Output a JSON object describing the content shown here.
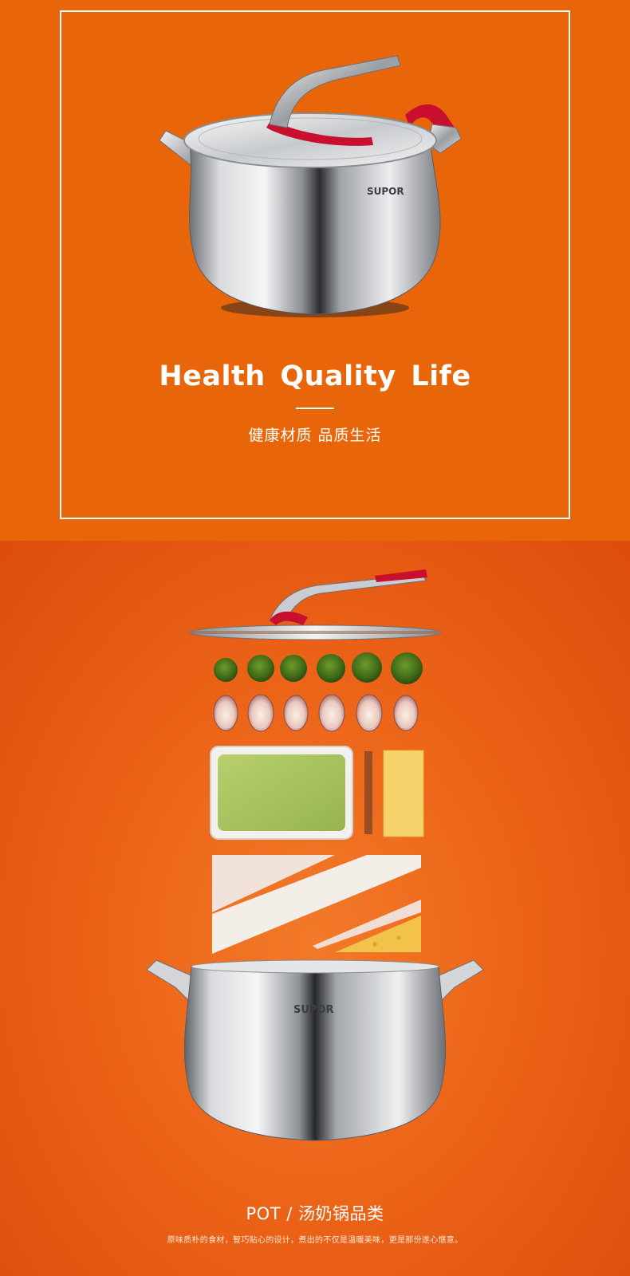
{
  "hero": {
    "title": "Health Quality Life",
    "subtitle": "健康材质 品质生活",
    "brand_mark": "SUPOR",
    "background_color": "#e8650a"
  },
  "flatlay": {
    "brand_mark": "SUPOR",
    "ingredient_rows": [
      {
        "name": "broccoli-row",
        "count": 6
      },
      {
        "name": "shallot-row",
        "count": 6
      }
    ]
  },
  "caption": {
    "title": "POT / 汤奶锅品类",
    "description": "原味质朴的食材，智巧贴心的设计，煮出的不仅是温暖美味，更是那份遂心惬意。"
  },
  "colors": {
    "orange": "#e8650a",
    "accent_red": "#c8102e",
    "steel": "#c9ccd0"
  }
}
